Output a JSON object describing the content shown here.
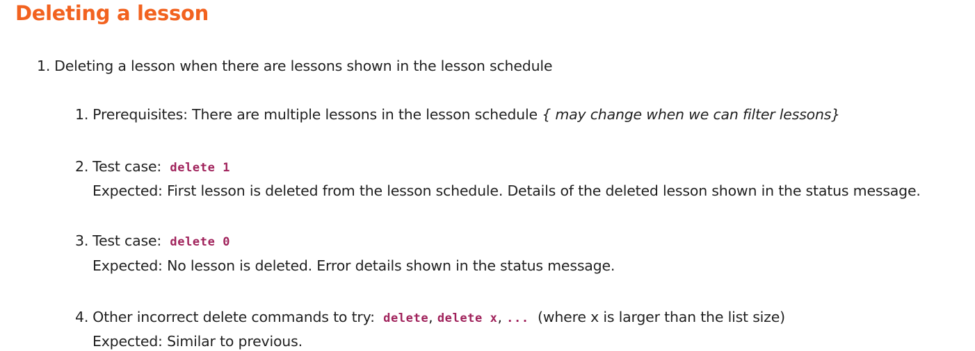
{
  "page": {
    "title": "Deleting a lesson"
  },
  "item1": {
    "number": "1.",
    "text": "Deleting a lesson when there are lessons shown in the lesson schedule"
  },
  "sub1": {
    "number": "1.",
    "text": "Prerequisites: There are multiple lessons in the lesson schedule ",
    "note": "{ may change when we can filter lessons}"
  },
  "sub2": {
    "number": "2.",
    "prefix": "Test case:",
    "code": "delete 1",
    "expected": "Expected: First lesson is deleted from the lesson schedule. Details of the deleted lesson shown in the status message."
  },
  "sub3": {
    "number": "3.",
    "prefix": "Test case:",
    "code": "delete 0",
    "expected": "Expected: No lesson is deleted. Error details shown in the status message."
  },
  "sub4": {
    "number": "4.",
    "prefix": "Other incorrect delete commands to try:",
    "code1": "delete",
    "sep1": ",",
    "code2": "delete x",
    "sep2": ",",
    "code3": "...",
    "suffix": "(where x is larger than the list size)",
    "expected": "Expected: Similar to previous."
  }
}
